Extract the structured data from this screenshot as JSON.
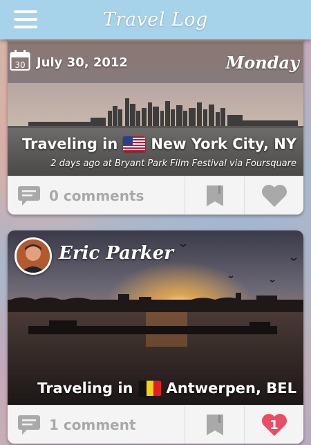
{
  "header": {
    "title": "Travel Log",
    "menu_icon": "hamburger-menu-icon",
    "color": "#a7d3ea"
  },
  "posts": [
    {
      "date": {
        "calendar_day": "30",
        "full_date": "July 30, 2012",
        "weekday": "Monday"
      },
      "traveling_prefix": "Traveling in",
      "location": "New York City, NY",
      "flag": "us-flag",
      "subline": "2 days ago at Bryant Park Film Festival via Foursquare",
      "comments_label": "0 comments",
      "liked": false
    },
    {
      "author": "Eric Parker",
      "traveling_prefix": "Traveling in",
      "location": "Antwerpen, BEL",
      "flag": "belgium-flag",
      "comments_label": "1 comment",
      "likes_count": "1",
      "liked": true,
      "like_color": "#e94d64"
    }
  ]
}
